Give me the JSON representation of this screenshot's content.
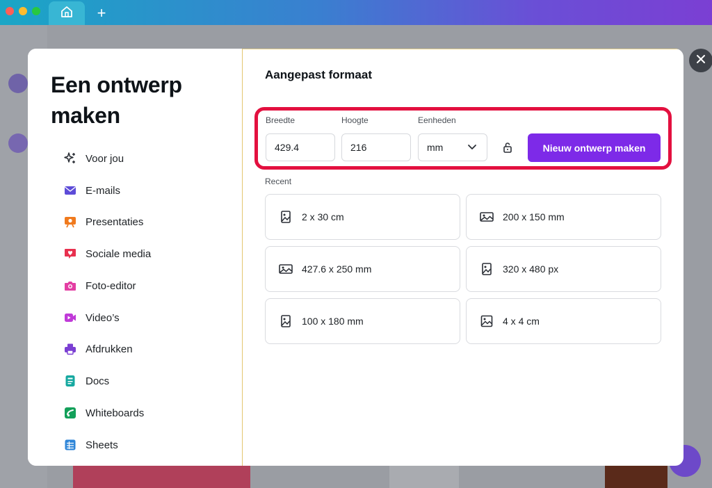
{
  "browser": {
    "home_tab_icon": "home-icon",
    "new_tab_label": "+"
  },
  "modal": {
    "title": "Een ontwerp maken",
    "nav": [
      {
        "label": "Voor jou",
        "icon": "sparkles-icon",
        "color": "#2b2f36"
      },
      {
        "label": "E-mails",
        "icon": "mail-icon",
        "color": "#5d4cd8"
      },
      {
        "label": "Presentaties",
        "icon": "presentation-icon",
        "color": "#f07a1d"
      },
      {
        "label": "Sociale media",
        "icon": "heart-message-icon",
        "color": "#e8314f"
      },
      {
        "label": "Foto-editor",
        "icon": "camera-icon",
        "color": "#e33ea3"
      },
      {
        "label": "Video’s",
        "icon": "video-icon",
        "color": "#c03ad8"
      },
      {
        "label": "Afdrukken",
        "icon": "printer-icon",
        "color": "#7b3fd3"
      },
      {
        "label": "Docs",
        "icon": "doc-icon",
        "color": "#16a8a0"
      },
      {
        "label": "Whiteboards",
        "icon": "whiteboard-icon",
        "color": "#13a05a"
      },
      {
        "label": "Sheets",
        "icon": "sheet-icon",
        "color": "#2f86d8"
      }
    ],
    "custom": {
      "title": "Aangepast formaat",
      "width_label": "Breedte",
      "width_value": "429.4",
      "height_label": "Hoogte",
      "height_value": "216",
      "units_label": "Eenheden",
      "units_value": "mm",
      "create_button": "Nieuw ontwerp maken",
      "accent": "#7d2ae8",
      "highlight_color": "#e3103f"
    },
    "recent_label": "Recent",
    "recent": [
      {
        "label": "2 x 30 cm",
        "icon": "portrait-image-icon"
      },
      {
        "label": "200 x 150 mm",
        "icon": "landscape-image-icon"
      },
      {
        "label": "427.6 x 250 mm",
        "icon": "landscape-image-icon"
      },
      {
        "label": "320 x 480 px",
        "icon": "portrait-image-icon"
      },
      {
        "label": "100 x 180 mm",
        "icon": "portrait-image-icon"
      },
      {
        "label": "4 x 4 cm",
        "icon": "square-image-icon"
      }
    ]
  }
}
